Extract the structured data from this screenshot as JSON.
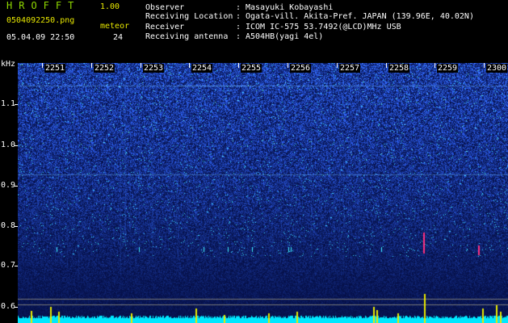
{
  "header": {
    "app_title": "HROFFT",
    "app_version": "1.00",
    "file_name": "0504092250.png",
    "meteor_label": "meteor",
    "date_time": "05.04.09 22:50",
    "meteor_count": "24"
  },
  "station": [
    {
      "label": "Observer",
      "value": "Masayuki Kobayashi"
    },
    {
      "label": "Receiving Location",
      "value": "Ogata-vill. Akita-Pref. JAPAN (139.96E, 40.02N)"
    },
    {
      "label": "Receiver",
      "value": "ICOM IC-575 53.7492(@LCD)MHz USB"
    },
    {
      "label": "Receiving antenna",
      "value": "A504HB(yagi 4el)"
    }
  ],
  "separator": ":",
  "spectrogram": {
    "y_unit": "kHz",
    "y_ticks": [
      "1.1",
      "1.0",
      "0.9",
      "0.8",
      "0.7",
      "0.6"
    ],
    "x_ticks": [
      "2251",
      "2252",
      "2253",
      "2254",
      "2255",
      "2256",
      "2257",
      "2258",
      "2259",
      "2300"
    ],
    "colors": {
      "background": "#000000",
      "noise_low": "#0a1a7a",
      "noise_high": "#2a60ff",
      "signal": "#40f0ff",
      "meteor_marker": "#e8e800",
      "echo": "#ff3080"
    }
  }
}
